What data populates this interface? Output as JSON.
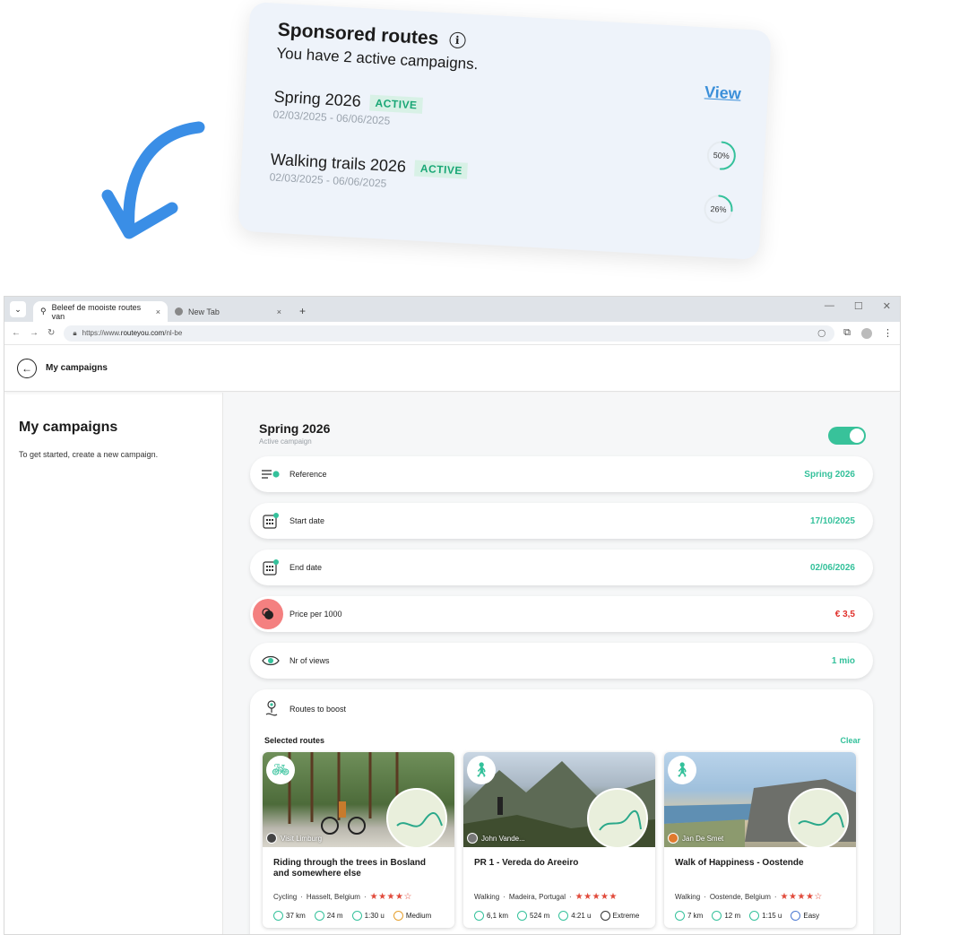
{
  "sponsored": {
    "title": "Sponsored routes",
    "subtitle": "You have 2 active campaigns.",
    "view_link": "View",
    "campaigns": [
      {
        "name": "Spring 2026",
        "status": "ACTIVE",
        "dates": "02/03/2025 - 06/06/2025",
        "progress_label": "50%",
        "progress": 0.5
      },
      {
        "name": "Walking trails 2026",
        "status": "ACTIVE",
        "dates": "02/03/2025 - 06/06/2025",
        "progress_label": "26%",
        "progress": 0.26
      }
    ]
  },
  "browser": {
    "tabs": [
      {
        "label": "Beleef de mooiste routes van",
        "close": "×"
      },
      {
        "label": "New Tab",
        "close": "×"
      }
    ],
    "new_tab": "+",
    "url_scheme": "https://www.",
    "url_host": "routeyou.com",
    "url_path": "/nl-be"
  },
  "app": {
    "header_title": "My campaigns",
    "left_title": "My campaigns",
    "left_text": "To get started, create a new campaign.",
    "campaign_title": "Spring 2026",
    "campaign_subtitle": "Active campaign",
    "toggle_on": true,
    "fields": [
      {
        "label": "Reference",
        "value": "Spring 2026"
      },
      {
        "label": "Start date",
        "value": "17/10/2025"
      },
      {
        "label": "End date",
        "value": "02/06/2026"
      },
      {
        "label": "Price per 1000",
        "value": "€ 3,5"
      },
      {
        "label": "Nr of views",
        "value": "1 mio"
      }
    ],
    "routes_to_boost": "Routes to boost",
    "selected_routes": "Selected routes",
    "clear": "Clear",
    "routes": [
      {
        "title": "Riding through the trees in Bosland and somewhere else",
        "author": "Visit Limburg",
        "activity": "Cycling",
        "location": "Hasselt, Belgium",
        "rating": 4,
        "stars": "★★★★☆",
        "distance": "37 km",
        "ascent": "24 m",
        "duration": "1:30 u",
        "difficulty": "Medium"
      },
      {
        "title": "PR 1 - Vereda do Areeiro",
        "author": "John Vande...",
        "activity": "Walking",
        "location": "Madeira, Portugal",
        "rating": 5,
        "stars": "★★★★★",
        "distance": "6,1 km",
        "ascent": "524 m",
        "duration": "4:21 u",
        "difficulty": "Extreme"
      },
      {
        "title": "Walk of Happiness - Oostende",
        "author": "Jan De Smet",
        "activity": "Walking",
        "location": "Oostende, Belgium",
        "rating": 4,
        "stars": "★★★★☆",
        "distance": "7 km",
        "ascent": "12 m",
        "duration": "1:15 u",
        "difficulty": "Easy"
      }
    ]
  },
  "colors": {
    "accent": "#34c19b",
    "link": "#3b8fd9",
    "price": "#e0302b",
    "arrow": "#3a8ee6"
  }
}
